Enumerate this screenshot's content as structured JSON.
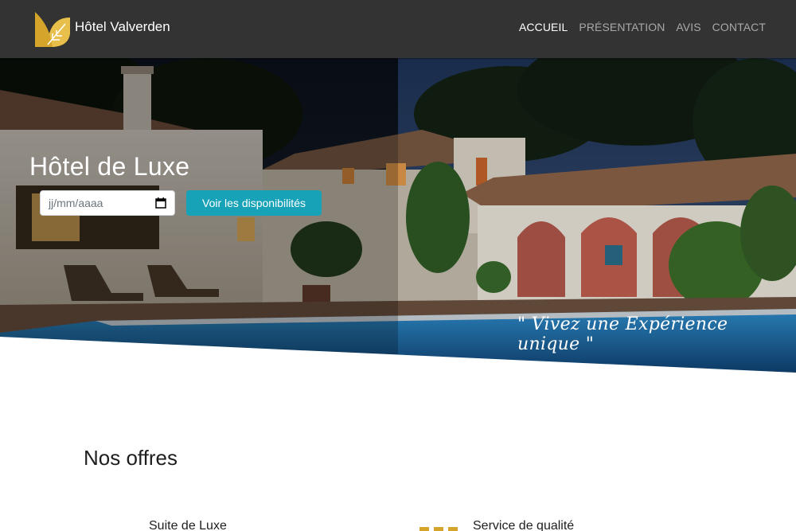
{
  "navbar": {
    "brand_name": "Hôtel Valverden",
    "logo_icon": "golden-leaf-icon",
    "items": [
      {
        "label": "ACCUEIL",
        "active": true
      },
      {
        "label": "PRÉSENTATION",
        "active": false
      },
      {
        "label": "AVIS",
        "active": false
      },
      {
        "label": "CONTACT",
        "active": false
      }
    ]
  },
  "hero": {
    "title": "Hôtel de Luxe",
    "date_placeholder": "jj/mm/aaaa",
    "availability_button": "Voir les disponibilités",
    "tagline": "\" Vivez une Expérience unique \""
  },
  "offers": {
    "title": "Nos offres",
    "items": [
      {
        "label": "Suite de Luxe"
      },
      {
        "label": "Service de qualité"
      }
    ]
  },
  "colors": {
    "navbar_bg": "#333333",
    "accent_button": "#17a2b8",
    "brand_gold": "#d4a52a"
  }
}
